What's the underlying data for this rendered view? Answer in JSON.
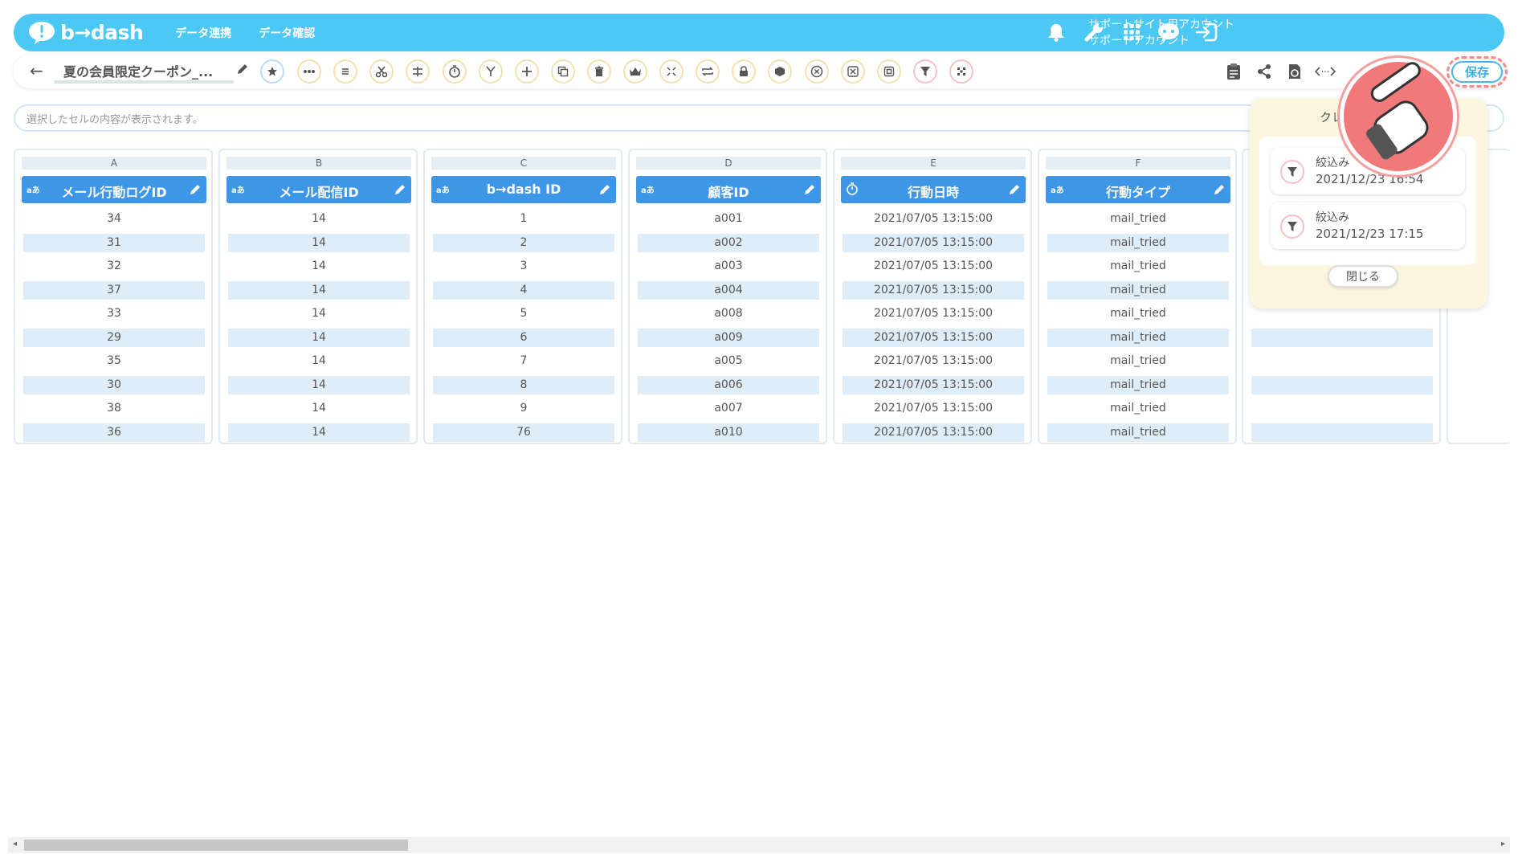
{
  "header": {
    "logo_text": "b→dash",
    "nav": [
      "データ連携",
      "データ確認"
    ],
    "account_line1": "サポートサイト用アカウント",
    "account_line2": "サポートアカウント",
    "icons": [
      "bell-icon",
      "wrench-icon",
      "grid-apps-icon",
      "chatbot-icon",
      "logout-icon"
    ]
  },
  "toolbar": {
    "back_label": "←",
    "title": "夏の会員限定クーポン_...",
    "save_label": "保存",
    "tool_icons": [
      "star-icon",
      "more-icon",
      "list-icon",
      "scissors-icon",
      "split-icon",
      "timer-icon",
      "merge-icon",
      "add-icon",
      "copy-icon",
      "trash-icon",
      "crown-icon",
      "shrink-icon",
      "repeat-icon",
      "lock-icon",
      "box-icon",
      "cancel-icon",
      "shuffle-icon",
      "frame-icon",
      "filter-icon",
      "pattern-icon"
    ],
    "right_icons": [
      "clipboard-icon",
      "share-icon",
      "refresh-doc-icon",
      "code-icon"
    ]
  },
  "cellbar": {
    "placeholder": "選択したセルの内容が表示されます。"
  },
  "columns": [
    {
      "letter": "A",
      "type": "aあ",
      "name": "メール行動ログID",
      "values": [
        "34",
        "31",
        "32",
        "37",
        "33",
        "29",
        "35",
        "30",
        "38",
        "36"
      ]
    },
    {
      "letter": "B",
      "type": "aあ",
      "name": "メール配信ID",
      "values": [
        "14",
        "14",
        "14",
        "14",
        "14",
        "14",
        "14",
        "14",
        "14",
        "14"
      ]
    },
    {
      "letter": "C",
      "type": "aあ",
      "name": "b→dash ID",
      "values": [
        "1",
        "2",
        "3",
        "4",
        "5",
        "6",
        "7",
        "8",
        "9",
        "76"
      ]
    },
    {
      "letter": "D",
      "type": "aあ",
      "name": "顧客ID",
      "values": [
        "a001",
        "a002",
        "a003",
        "a004",
        "a008",
        "a009",
        "a005",
        "a006",
        "a007",
        "a010"
      ]
    },
    {
      "letter": "E",
      "type": "timer",
      "name": "行動日時",
      "values": [
        "2021/07/05 13:15:00",
        "2021/07/05 13:15:00",
        "2021/07/05 13:15:00",
        "2021/07/05 13:15:00",
        "2021/07/05 13:15:00",
        "2021/07/05 13:15:00",
        "2021/07/05 13:15:00",
        "2021/07/05 13:15:00",
        "2021/07/05 13:15:00",
        "2021/07/05 13:15:00"
      ]
    },
    {
      "letter": "F",
      "type": "aあ",
      "name": "行動タイプ",
      "values": [
        "mail_tried",
        "mail_tried",
        "mail_tried",
        "mail_tried",
        "mail_tried",
        "mail_tried",
        "mail_tried",
        "mail_tried",
        "mail_tried",
        "mail_tried"
      ]
    }
  ],
  "popup": {
    "title": "クレ",
    "items": [
      {
        "label": "絞込み",
        "date": "2021/12/23 16:54"
      },
      {
        "label": "絞込み",
        "date": "2021/12/23 17:15"
      }
    ],
    "close_label": "閉じる"
  },
  "colors": {
    "header_bg": "#4cc8f5",
    "column_header": "#3d96e6",
    "row_stripe": "#deedf8",
    "popup_bg": "#fdf6df",
    "pointer": "#f07a7a"
  }
}
